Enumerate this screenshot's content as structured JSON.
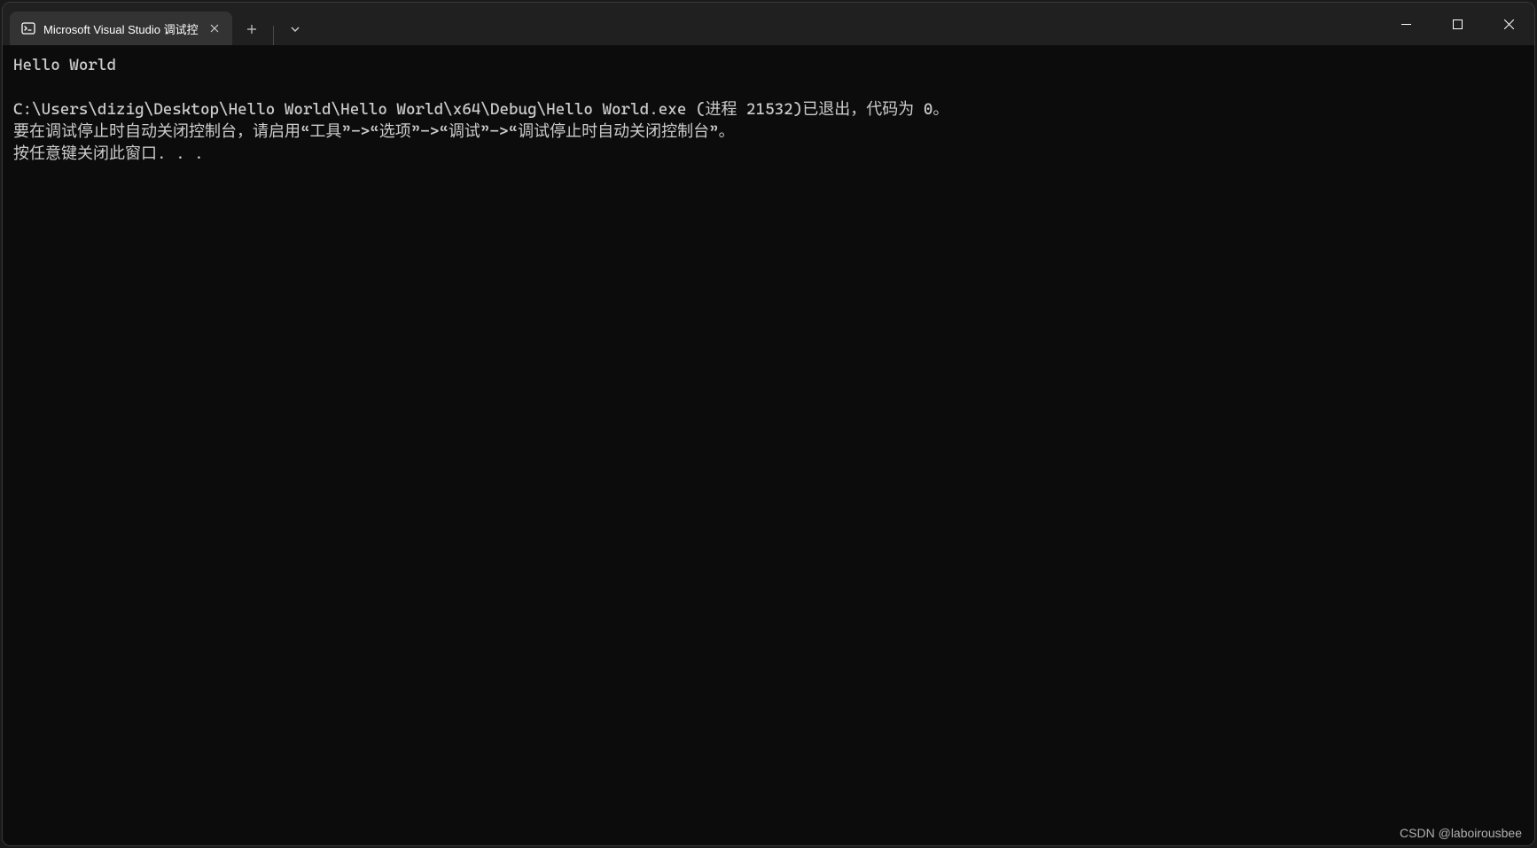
{
  "tab": {
    "title": "Microsoft Visual Studio 调试控"
  },
  "console": {
    "line1": "Hello World",
    "line2": "",
    "line3": "C:\\Users\\dizig\\Desktop\\Hello World\\Hello World\\x64\\Debug\\Hello World.exe (进程 21532)已退出，代码为 0。",
    "line4": "要在调试停止时自动关闭控制台，请启用“工具”->“选项”->“调试”->“调试停止时自动关闭控制台”。",
    "line5": "按任意键关闭此窗口. . ."
  },
  "watermark": "CSDN @laboirousbee"
}
